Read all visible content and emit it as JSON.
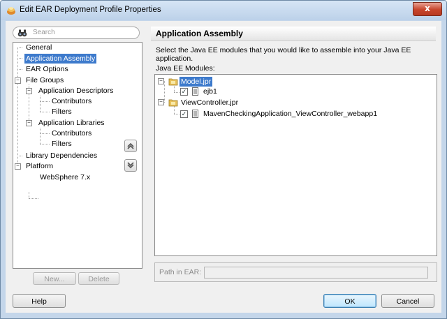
{
  "window": {
    "title": "Edit EAR Deployment Profile Properties",
    "close_glyph": "x"
  },
  "search": {
    "placeholder": "Search"
  },
  "nav_tree": {
    "items": [
      {
        "label": "General"
      },
      {
        "label": "Application Assembly",
        "selected": true
      },
      {
        "label": "EAR Options"
      },
      {
        "label": "File Groups"
      },
      {
        "label": "Application Descriptors"
      },
      {
        "label": "Contributors"
      },
      {
        "label": "Filters"
      },
      {
        "label": "Application Libraries"
      },
      {
        "label": "Contributors"
      },
      {
        "label": "Filters"
      },
      {
        "label": "Library Dependencies"
      },
      {
        "label": "Platform"
      },
      {
        "label": "WebSphere 7.x"
      }
    ],
    "expander_glyph": "−"
  },
  "left_buttons": {
    "new_label": "New...",
    "delete_label": "Delete"
  },
  "section": {
    "title": "Application Assembly",
    "description": "Select the Java EE modules that you would like to assemble into your Java EE application.",
    "modules_label": "Java EE Modules:"
  },
  "modules_tree": {
    "items": [
      {
        "label": "Model.jpr",
        "type": "project",
        "selected": true
      },
      {
        "label": "ejb1",
        "type": "module",
        "checked": true
      },
      {
        "label": "ViewController.jpr",
        "type": "project"
      },
      {
        "label": "MavenCheckingApplication_ViewController_webapp1",
        "type": "module",
        "checked": true
      }
    ],
    "check_glyph": "✓"
  },
  "path": {
    "label": "Path in EAR:",
    "value": ""
  },
  "footer": {
    "help_label": "Help",
    "ok_label": "OK",
    "cancel_label": "Cancel"
  },
  "colors": {
    "selection": "#3d7acc",
    "frame": "#c4d6ea",
    "close_button": "#c7452c"
  },
  "icons": [
    "app-icon",
    "binoculars-icon",
    "move-up-icon",
    "move-down-icon",
    "folder-icon",
    "file-icon",
    "checkbox-icon",
    "collapse-icon"
  ]
}
